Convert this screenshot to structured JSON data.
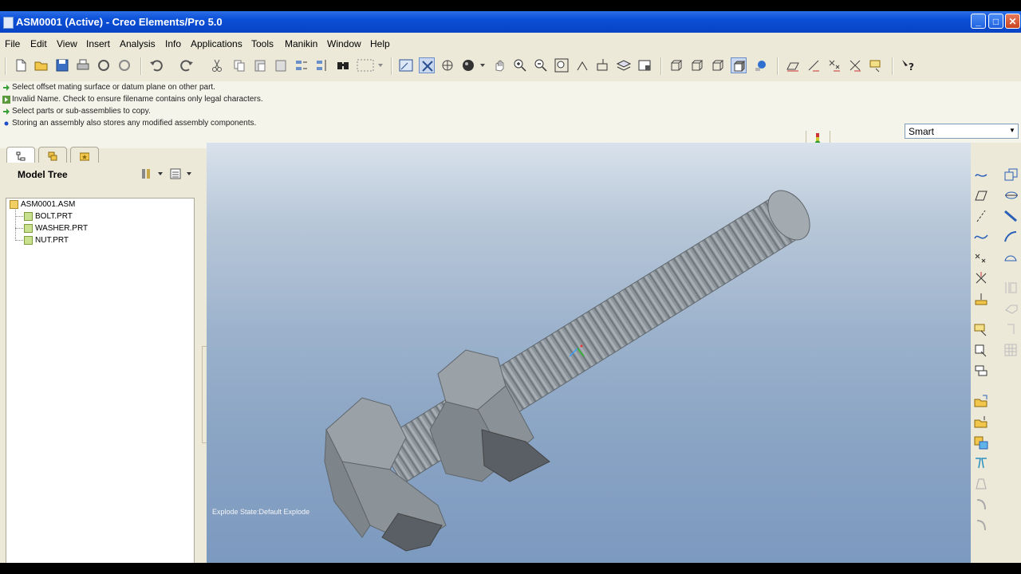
{
  "window": {
    "title": "ASM0001 (Active) - Creo Elements/Pro 5.0",
    "buttons": {
      "minimize": "_",
      "maximize": "□",
      "close": "✕"
    }
  },
  "menu": [
    "File",
    "Edit",
    "View",
    "Insert",
    "Analysis",
    "Info",
    "Applications",
    "Tools",
    "Manikin",
    "Window",
    "Help"
  ],
  "messages": [
    {
      "icon": "arrow-right-green-icon",
      "text": "Select offset mating surface or datum plane on other part."
    },
    {
      "icon": "warning-icon",
      "text": "Invalid Name.  Check to ensure filename contains only legal characters."
    },
    {
      "icon": "arrow-right-green-icon",
      "text": "Select parts or sub-assemblies to copy."
    },
    {
      "icon": "bullet-info-icon",
      "text": "Storing an assembly also stores any modified assembly components."
    }
  ],
  "filter": {
    "selected": "Smart"
  },
  "model_tree": {
    "title": "Model Tree",
    "nodes": [
      {
        "label": "ASM0001.ASM",
        "level": 0,
        "type": "assembly"
      },
      {
        "label": "BOLT.PRT",
        "level": 1,
        "type": "part"
      },
      {
        "label": "WASHER.PRT",
        "level": 1,
        "type": "part"
      },
      {
        "label": "NUT.PRT",
        "level": 1,
        "type": "part"
      }
    ]
  },
  "viewport": {
    "explode_state": "Explode State:Default Explode"
  },
  "colors": {
    "titlebar": "#0a4fd6",
    "viewport_top": "#d9e2ec",
    "viewport_bottom": "#7c99bf",
    "model_gray": "#8e969d"
  }
}
